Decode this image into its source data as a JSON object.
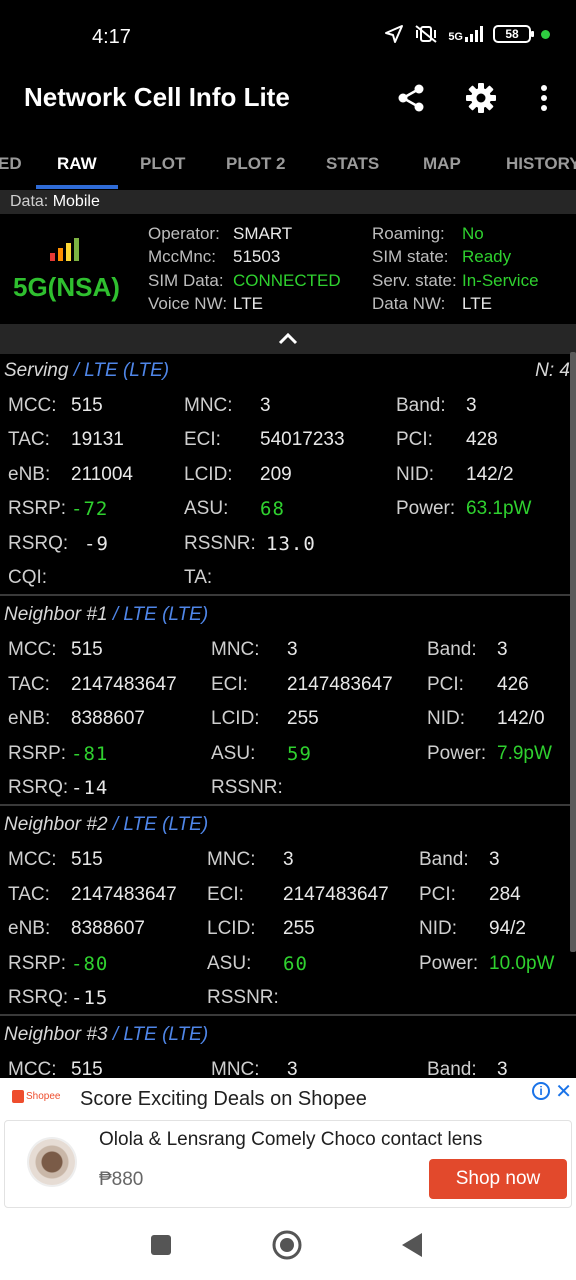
{
  "status_bar": {
    "time": "4:17",
    "network_tag": "5G",
    "battery": "58"
  },
  "app": {
    "title": "Network Cell Info Lite"
  },
  "tabs": [
    {
      "label": "ED"
    },
    {
      "label": "RAW"
    },
    {
      "label": "PLOT"
    },
    {
      "label": "PLOT 2"
    },
    {
      "label": "STATS"
    },
    {
      "label": "MAP"
    },
    {
      "label": "HISTORY"
    }
  ],
  "active_tab": "RAW",
  "data_line": {
    "label": "Data:",
    "value": "Mobile"
  },
  "summary": {
    "network_type": "5G(NSA)",
    "operator_label": "Operator:",
    "operator": "SMART",
    "mccmnc_label": "MccMnc:",
    "mccmnc": "51503",
    "sim_data_label": "SIM Data:",
    "sim_data": "CONNECTED",
    "voice_nw_label": "Voice NW:",
    "voice_nw": "LTE",
    "roaming_label": "Roaming:",
    "roaming": "No",
    "sim_state_label": "SIM state:",
    "sim_state": "Ready",
    "serv_state_label": "Serv. state:",
    "serv_state": "In-Service",
    "data_nw_label": "Data NW:",
    "data_nw": "LTE"
  },
  "labels": {
    "mcc": "MCC:",
    "mnc": "MNC:",
    "band": "Band:",
    "tac": "TAC:",
    "eci": "ECI:",
    "pci": "PCI:",
    "enb": "eNB:",
    "lcid": "LCID:",
    "nid": "NID:",
    "rsrp": "RSRP:",
    "asu": "ASU:",
    "power": "Power:",
    "rsrq": "RSRQ:",
    "rssnr": "RSSNR:",
    "cqi": "CQI:",
    "ta": "TA:"
  },
  "serving": {
    "title": "Serving",
    "tech": "/ LTE (LTE)",
    "n_count": "N: 4",
    "mcc": "515",
    "mnc": "3",
    "band": "3",
    "tac": "19131",
    "eci": "54017233",
    "pci": "428",
    "enb": "211004",
    "lcid": "209",
    "nid": "142/2",
    "rsrp": "-72",
    "asu": "68",
    "power": "63.1pW",
    "rsrq": "-9",
    "rssnr": "13.0",
    "cqi": "",
    "ta": ""
  },
  "neighbors": [
    {
      "title": "Neighbor #1",
      "tech": "/ LTE (LTE)",
      "mcc": "515",
      "mnc": "3",
      "band": "3",
      "tac": "2147483647",
      "eci": "2147483647",
      "pci": "426",
      "enb": "8388607",
      "lcid": "255",
      "nid": "142/0",
      "rsrp": "-81",
      "asu": "59",
      "power": "7.9pW",
      "rsrq": "-14",
      "rssnr": ""
    },
    {
      "title": "Neighbor #2",
      "tech": "/ LTE (LTE)",
      "mcc": "515",
      "mnc": "3",
      "band": "3",
      "tac": "2147483647",
      "eci": "2147483647",
      "pci": "284",
      "enb": "8388607",
      "lcid": "255",
      "nid": "94/2",
      "rsrp": "-80",
      "asu": "60",
      "power": "10.0pW",
      "rsrq": "-15",
      "rssnr": ""
    },
    {
      "title": "Neighbor #3",
      "tech": "/ LTE (LTE)",
      "mcc": "515",
      "mnc": "3",
      "band": "3"
    }
  ],
  "ad": {
    "brand": "Shopee",
    "headline": "Score Exciting Deals on Shopee",
    "info_icon": "i",
    "close_icon": "✕",
    "product": "Olola & Lensrang Comely Choco contact lens",
    "price": "₱880",
    "cta": "Shop now"
  },
  "colors": {
    "green": "#2fd12f",
    "blue": "#4f86e8",
    "tab_indicator": "#2f6bd6",
    "cta": "#e2492c"
  }
}
